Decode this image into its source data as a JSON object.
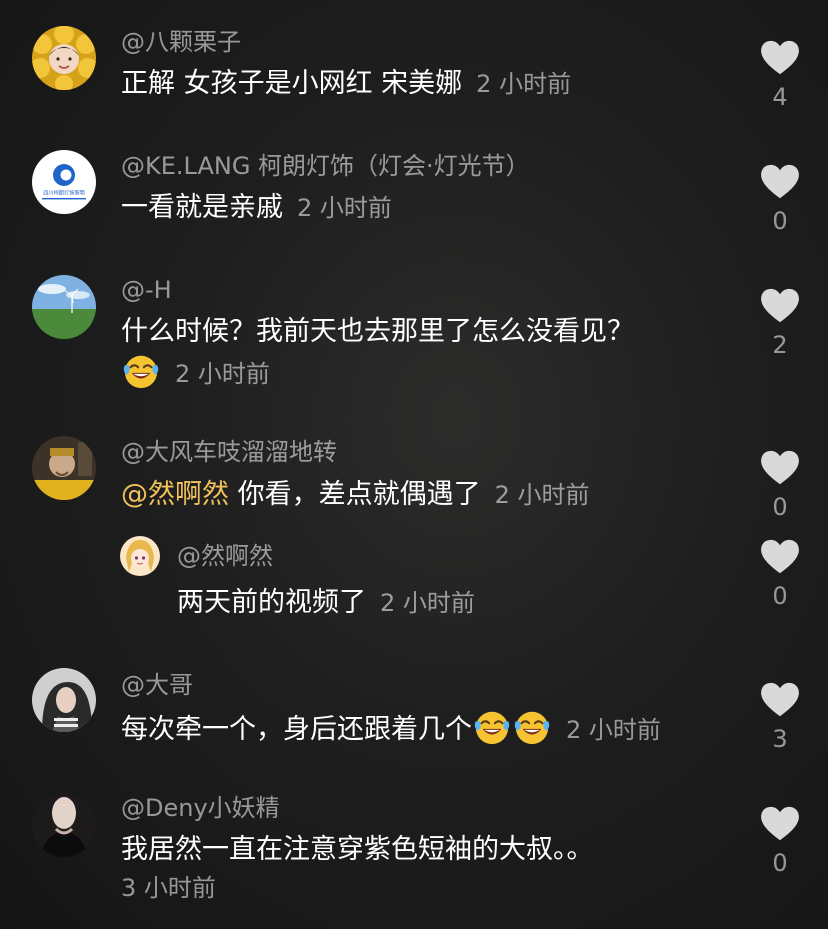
{
  "comments": [
    {
      "user": "@八颗栗子",
      "text": "正解 女孩子是小网红 宋美娜",
      "time": "2 小时前",
      "likes": "4"
    },
    {
      "user": "@KE.LANG 柯朗灯饰（灯会·灯光节）",
      "text": "一看就是亲戚",
      "time": "2 小时前",
      "likes": "0",
      "avatar_text": "四川柯朗灯饰照明"
    },
    {
      "user": "@-H",
      "text": "什么时候？我前天也去那里了怎么没看见？",
      "time": "2 小时前",
      "likes": "2"
    },
    {
      "user": "@大风车吱溜溜地转",
      "mention": "@然啊然",
      "text": "你看，差点就偶遇了",
      "time": "2 小时前",
      "likes": "0"
    },
    {
      "user": "@然啊然",
      "text": "两天前的视频了",
      "time": "2 小时前",
      "likes": "0"
    },
    {
      "user": "@大哥",
      "text": "每次牵一个，身后还跟着几个",
      "time": "2 小时前",
      "likes": "3"
    },
    {
      "user": "@Deny小妖精",
      "text": "我居然一直在注意穿紫色短袖的大叔。。",
      "time": "3 小时前",
      "likes": "0"
    }
  ],
  "icons": {
    "like": "heart-icon",
    "emoji": "tears-of-joy-emoji"
  },
  "colors": {
    "background": "#1e1e1e",
    "text": "#ffffff",
    "secondary": "#8c8c8c",
    "mention": "#f1c15a",
    "like_icon": "#d9d9d9"
  }
}
